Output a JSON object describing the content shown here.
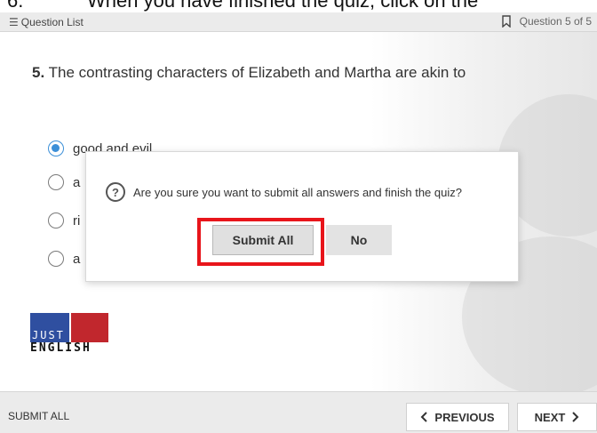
{
  "instruction": {
    "step": "6.",
    "text": "When you have finished the quiz, click on the"
  },
  "topbar": {
    "question_list_label": "Question List",
    "question_counter": "Question 5 of 5"
  },
  "question": {
    "number": "5.",
    "text": "The contrasting characters of Elizabeth and Martha are akin to"
  },
  "options": [
    {
      "label": "good and evil",
      "selected": true
    },
    {
      "label": "a",
      "selected": false
    },
    {
      "label": "ri",
      "selected": false
    },
    {
      "label": "a",
      "selected": false
    }
  ],
  "logo": {
    "line1": "JUST",
    "line2": "ENGLISH",
    "colors": [
      "#2f4fa0",
      "#c1272d"
    ]
  },
  "dialog": {
    "message": "Are you sure you want to submit all answers and finish the quiz?",
    "submit_label": "Submit All",
    "no_label": "No"
  },
  "bottombar": {
    "submit_all_label": "SUBMIT ALL",
    "previous_label": "PREVIOUS",
    "next_label": "NEXT"
  },
  "colors": {
    "accent": "#3b8fd8",
    "highlight": "#e8151b"
  }
}
